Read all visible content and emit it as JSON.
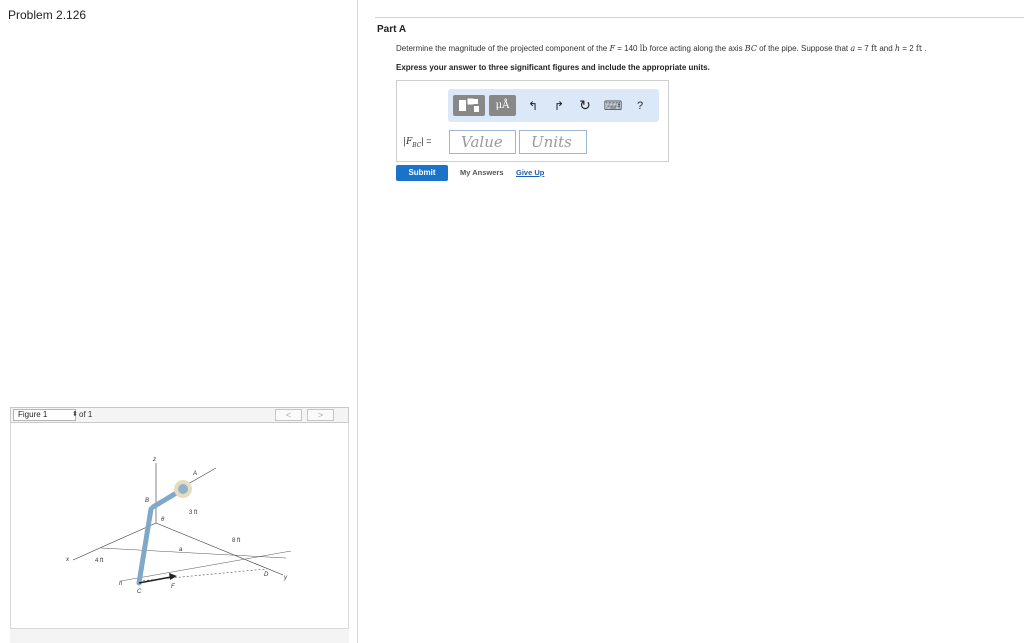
{
  "problem": {
    "title": "Problem 2.126"
  },
  "figure": {
    "selector_label": "Figure 1",
    "of_label": "of 1",
    "prev": "<",
    "next": ">",
    "labels": {
      "z": "z",
      "A": "A",
      "B": "B",
      "C": "C",
      "D": "D",
      "F": "F",
      "x": "x",
      "y": "y",
      "h": "h",
      "a": "a",
      "theta": "θ",
      "d4": "4 ft",
      "d3": "3 ft",
      "d8": "8 ft"
    }
  },
  "part": {
    "label": "Part A",
    "q1": "Determine the magnitude of the projected component of the ",
    "q_F": "F",
    "q2": " = 140 ",
    "q_lb": "lb",
    "q3": " force acting along the axis ",
    "q_BC": "BC",
    "q4": " of the pipe. Suppose that ",
    "q_a": "a",
    "q5": " = 7 ",
    "q_ft1": "ft",
    "q6": " and ",
    "q_h": "h",
    "q7": " = 2 ",
    "q_ft2": "ft",
    "q8": " .",
    "instruction": "Express your answer to three significant figures and include the appropriate units."
  },
  "toolbar": {
    "mu": "μÅ",
    "undo": "↰",
    "redo": "↱",
    "reset": "↻",
    "keyboard": "⌨",
    "help": "?"
  },
  "answer": {
    "label": "|F",
    "label_sub": "BC",
    "label_end": "| =",
    "value_placeholder": "Value",
    "units_placeholder": "Units"
  },
  "actions": {
    "submit": "Submit",
    "my_answers": "My Answers",
    "give_up": "Give Up"
  }
}
